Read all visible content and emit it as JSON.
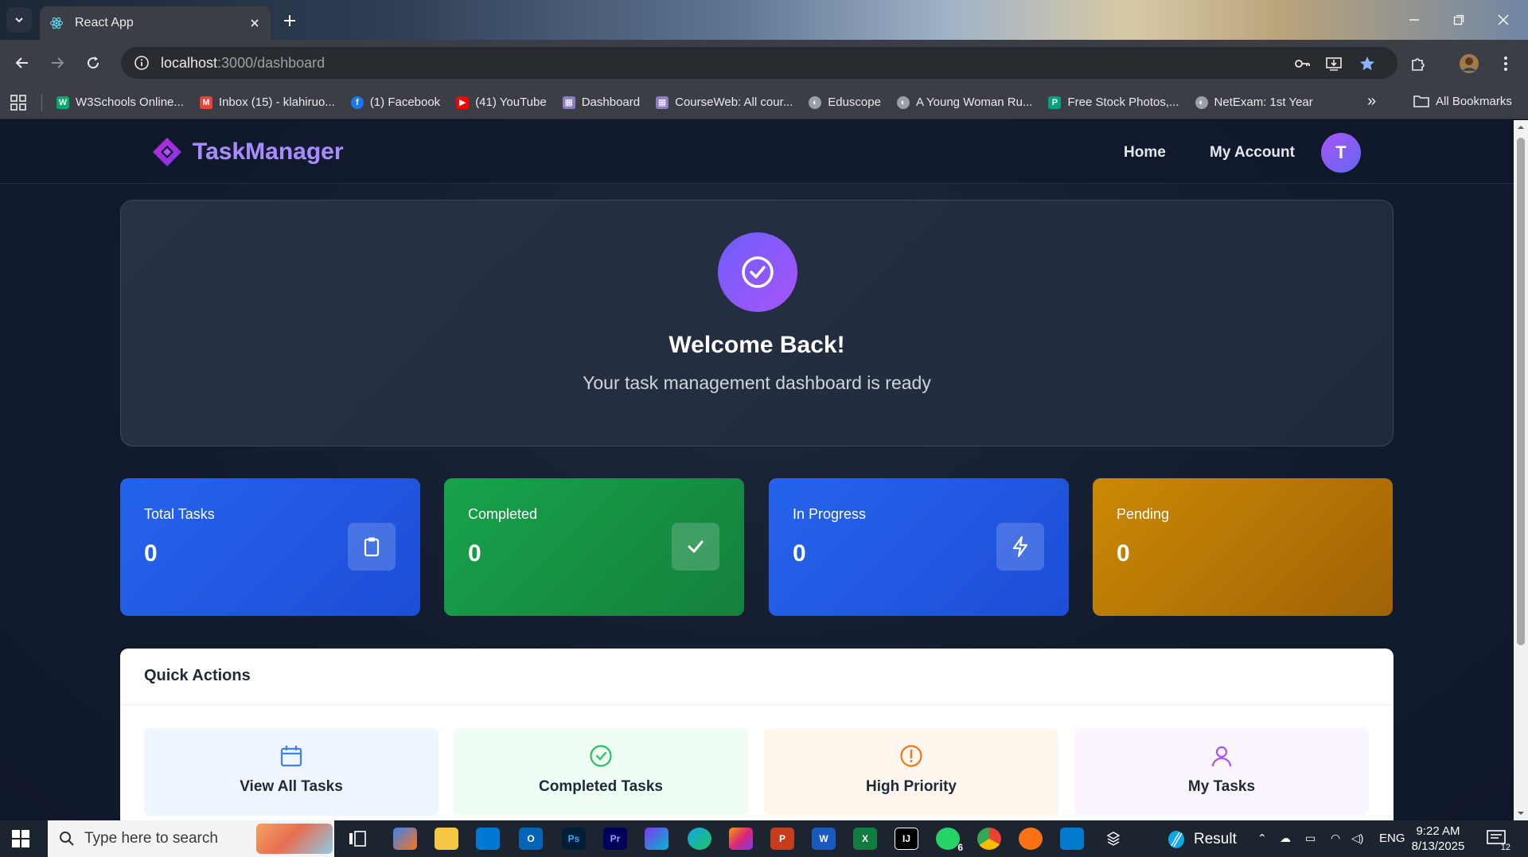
{
  "browser": {
    "tab_title": "React App",
    "url_host": "localhost",
    "url_path": ":3000/dashboard",
    "bookmarks": [
      {
        "label": "W3Schools Online...",
        "icon": "w3schools-icon",
        "color": "#04aa6d"
      },
      {
        "label": "Inbox (15) - klahiruo...",
        "icon": "gmail-icon",
        "color": "#ea4335"
      },
      {
        "label": "(1) Facebook",
        "icon": "facebook-icon",
        "color": "#1877f2"
      },
      {
        "label": "(41) YouTube",
        "icon": "youtube-icon",
        "color": "#ff0000"
      },
      {
        "label": "Dashboard",
        "icon": "dashboard-icon",
        "color": "#8e7cc3"
      },
      {
        "label": "CourseWeb: All cour...",
        "icon": "courseweb-icon",
        "color": "#8e7cc3"
      },
      {
        "label": "Eduscope",
        "icon": "globe-icon",
        "color": "#9aa0a6"
      },
      {
        "label": "A Young Woman Ru...",
        "icon": "globe-icon",
        "color": "#9aa0a6"
      },
      {
        "label": "Free Stock Photos,...",
        "icon": "pexels-icon",
        "color": "#05a081"
      },
      {
        "label": "NetExam: 1st Year",
        "icon": "globe-icon",
        "color": "#9aa0a6"
      }
    ],
    "all_bookmarks": "All Bookmarks"
  },
  "app": {
    "brand": "TaskManager",
    "nav": {
      "home": "Home",
      "account": "My Account"
    },
    "avatar_initial": "T",
    "welcome": {
      "title": "Welcome Back!",
      "subtitle": "Your task management dashboard is ready"
    },
    "stats": [
      {
        "label": "Total Tasks",
        "value": "0",
        "icon": "clipboard-icon",
        "color_from": "#2563eb",
        "color_to": "#1d4ed8"
      },
      {
        "label": "Completed",
        "value": "0",
        "icon": "check-icon",
        "color_from": "#16a34a",
        "color_to": "#15803d"
      },
      {
        "label": "In Progress",
        "value": "0",
        "icon": "lightning-icon",
        "color_from": "#2563eb",
        "color_to": "#1d4ed8"
      },
      {
        "label": "Pending",
        "value": "0",
        "icon": "clock-icon",
        "color_from": "#ca8a04",
        "color_to": "#a16207"
      }
    ],
    "quick_actions": {
      "title": "Quick Actions",
      "items": [
        {
          "label": "View All Tasks",
          "icon": "calendar-icon",
          "bg": "#eff6ff",
          "color": "#3b82f6"
        },
        {
          "label": "Completed Tasks",
          "icon": "check-circle-icon",
          "bg": "#f0fdf4",
          "color": "#22c55e"
        },
        {
          "label": "High Priority",
          "icon": "alert-circle-icon",
          "bg": "#fff7ed",
          "color": "#f97316"
        },
        {
          "label": "My Tasks",
          "icon": "user-icon",
          "bg": "#faf5ff",
          "color": "#a855f7"
        }
      ]
    }
  },
  "taskbar": {
    "search_placeholder": "Type here to search",
    "result_label": "Result",
    "language": "ENG",
    "time": "9:22 AM",
    "date": "8/13/2025",
    "whatsapp_badge": "6",
    "notification_count": "12"
  }
}
